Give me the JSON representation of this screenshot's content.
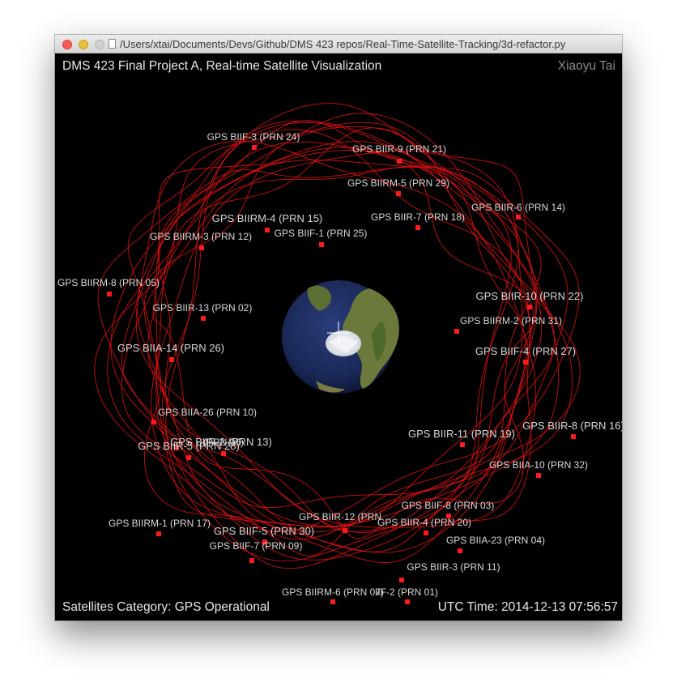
{
  "window": {
    "title": "/Users/xtai/Documents/Devs/Github/DMS 423 repos/Real-Time-Satellite-Tracking/3d-refactor.py"
  },
  "hud": {
    "title": "DMS 423 Final Project A, Real-time Satellite Visualization",
    "author": "Xiaoyu Tai",
    "category_label": "Satellites Category: GPS Operational",
    "utc_label": "UTC Time: 2014-12-13 07:56:57"
  },
  "colors": {
    "orbit": "#e01010",
    "satellite": "#ff1a1a",
    "label": "#d8d8d8",
    "background": "#000000"
  },
  "satellites": [
    {
      "label": "GPS BIIF-3  (PRN 24)"
    },
    {
      "label": "GPS BIIR-9  (PRN 21)"
    },
    {
      "label": "GPS BIIRM-5 (PRN 29)"
    },
    {
      "label": "GPS BIIR-6  (PRN 14)"
    },
    {
      "label": "GPS BIIRM-4 (PRN 15)"
    },
    {
      "label": "GPS BIIR-7  (PRN 18)"
    },
    {
      "label": "GPS BIIRM-3 (PRN 12)"
    },
    {
      "label": "GPS BIIF-1  (PRN 25)"
    },
    {
      "label": "GPS BIIRM-8 (PRN 05)"
    },
    {
      "label": "GPS BIIR-10 (PRN 22)"
    },
    {
      "label": "GPS BIIR-13 (PRN 02)"
    },
    {
      "label": "GPS BIIRM-2 (PRN 31)"
    },
    {
      "label": "GPS BIIA-14 (PRN 26)"
    },
    {
      "label": "GPS BIIF-4  (PRN 27)"
    },
    {
      "label": "GPS BIIA-26 (PRN 10)"
    },
    {
      "label": "GPS BIIR-8  (PRN 16)"
    },
    {
      "label": "GPS BIIR-2  (PRN 13)"
    },
    {
      "label": "GPS BIIR-11 (PRN 19)"
    },
    {
      "label": "(PRN 06)"
    },
    {
      "label": "GPS BIIR-5  (PRN 28)"
    },
    {
      "label": "GPS BIIA-10 (PRN 32)"
    },
    {
      "label": "GPS BIIF-8  (PRN 03)"
    },
    {
      "label": "GPS BIIRM-1 (PRN 17)"
    },
    {
      "label": "GPS BIIR-12 (PRN"
    },
    {
      "label": "GPS BIIR-4  (PRN 20)"
    },
    {
      "label": "GPS BIIF-5  (PRN 30)"
    },
    {
      "label": "GPS BIIA-23 (PRN 04)"
    },
    {
      "label": "GPS BIIF-7  (PRN 09)"
    },
    {
      "label": "GPS BIIR-3  (PRN 11)"
    },
    {
      "label": "GPS BIIRM-6 (PRN 07)"
    },
    {
      "label": "IIF-2  (PRN 01)"
    }
  ]
}
